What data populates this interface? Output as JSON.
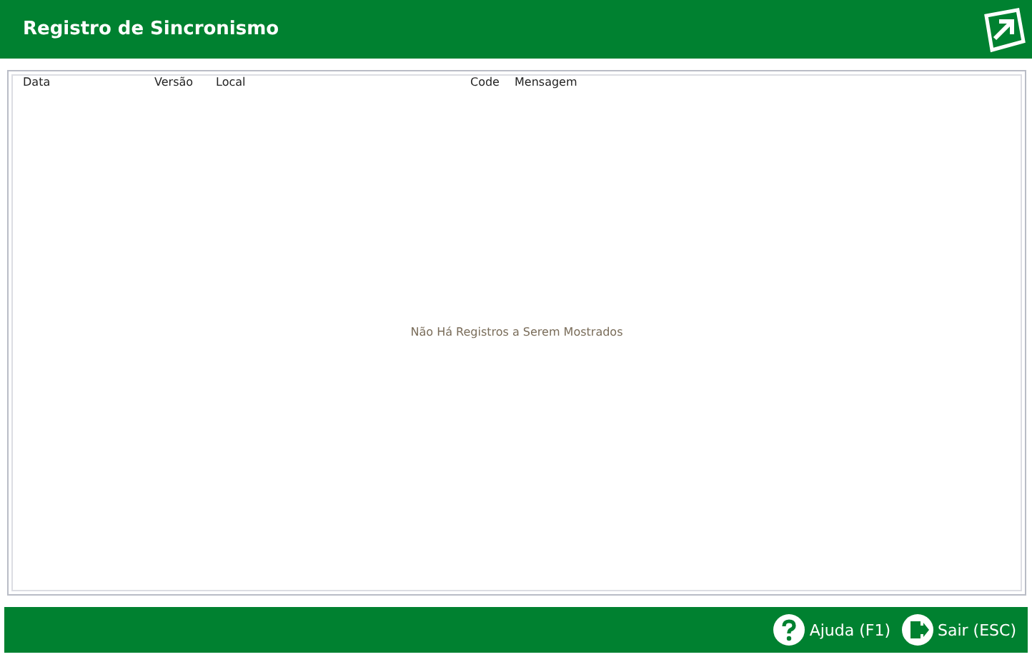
{
  "window": {
    "title": "Registro de Sincronismo"
  },
  "table": {
    "columns": [
      "Data",
      "Versão",
      "Local",
      "Code",
      "Mensagem"
    ],
    "empty_message": "Não Há Registros a Serem Mostrados"
  },
  "buttons": [
    {
      "kind": "help",
      "label": "Ajuda (F1)"
    },
    {
      "kind": "exit",
      "label": "Sair (ESC)"
    }
  ]
}
